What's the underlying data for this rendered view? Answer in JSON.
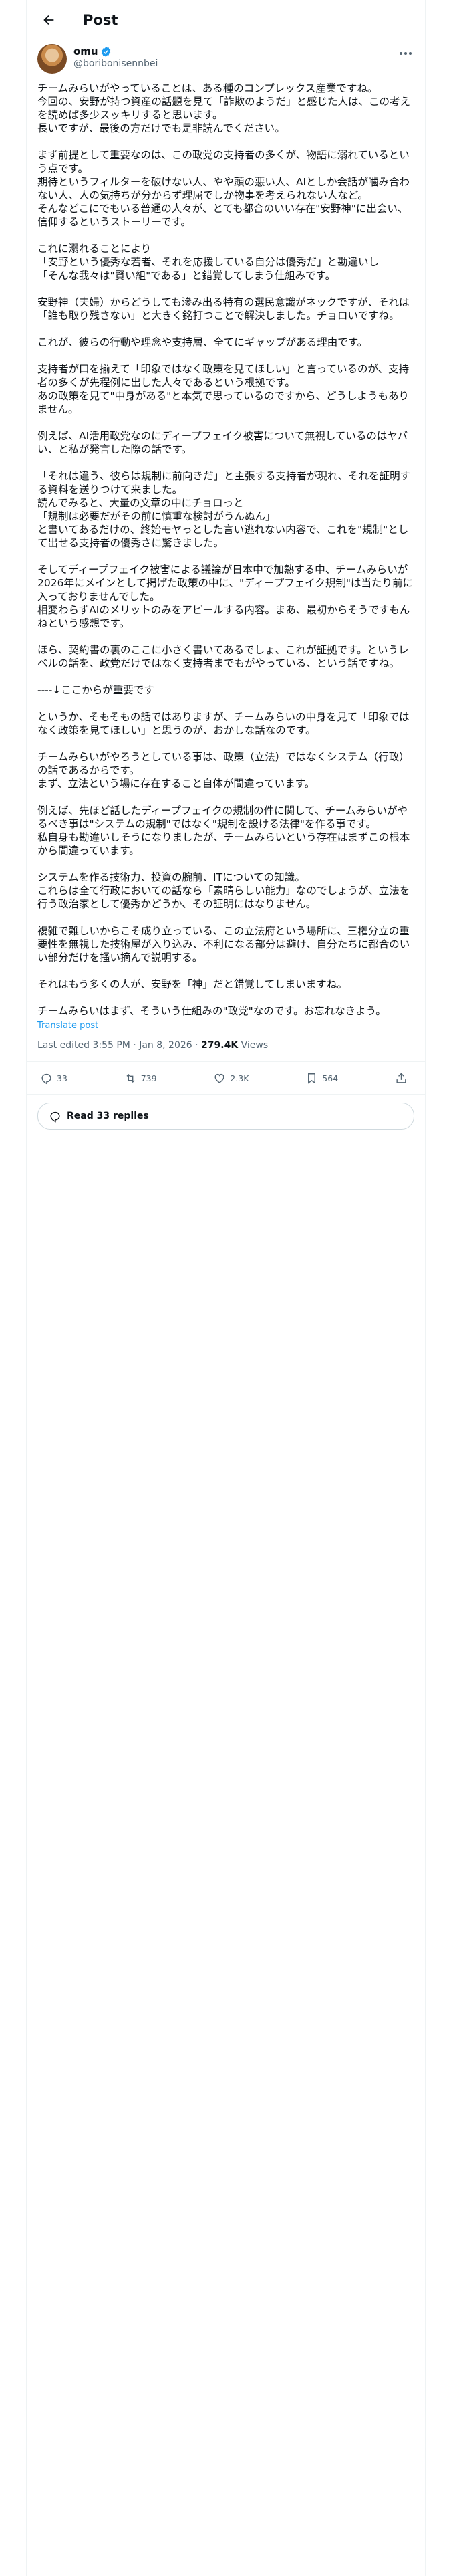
{
  "header": {
    "title": "Post"
  },
  "author": {
    "display_name": "omu",
    "handle": "@boribonisennbei"
  },
  "post": {
    "paragraphs": [
      [
        "チームみらいがやっていることは、ある種のコンプレックス産業ですね。",
        "今回の、安野が持つ資産の話題を見て「詐欺のようだ」と感じた人は、この考えを読めば多少スッキリすると思います。",
        "長いですが、最後の方だけでも是非読んでください。"
      ],
      [
        "まず前提として重要なのは、この政党の支持者の多くが、物語に溺れているという点です。",
        "期待というフィルターを破けない人、やや頭の悪い人、AIとしか会話が噛み合わない人、人の気持ちが分からず理屈でしか物事を考えられない人など。",
        "そんなどこにでもいる普通の人々が、とても都合のいい存在\"安野神\"に出会い、信仰するというストーリーです。"
      ],
      [
        "これに溺れることにより",
        "「安野という優秀な若者、それを応援している自分は優秀だ」と勘違いし",
        "「そんな我々は\"賢い組\"である」と錯覚してしまう仕組みです。"
      ],
      [
        "安野神（夫婦）からどうしても滲み出る特有の選民意識がネックですが、それは「誰も取り残さない」と大きく銘打つことで解決しました。チョロいですね。"
      ],
      [
        "これが、彼らの行動や理念や支持層、全てにギャップがある理由です。"
      ],
      [
        "支持者が口を揃えて「印象ではなく政策を見てほしい」と言っているのが、支持者の多くが先程例に出した人々であるという根拠です。",
        "あの政策を見て\"中身がある\"と本気で思っているのですから、どうしようもありません。"
      ],
      [
        "例えば、AI活用政党なのにディープフェイク被害について無視しているのはヤバい、と私が発言した際の話です。"
      ],
      [
        "「それは違う、彼らは規制に前向きだ」と主張する支持者が現れ、それを証明する資料を送りつけて来ました。",
        "読んでみると、大量の文章の中にチョロっと",
        "「規制は必要だがその前に慎重な検討がうんぬん」",
        "と書いてあるだけの、終始モヤっとした言い逃れない内容で、これを\"規制\"として出せる支持者の優秀さに驚きました。"
      ],
      [
        "そしてディープフェイク被害による議論が日本中で加熱する中、チームみらいが2026年にメインとして掲げた政策の中に、\"ディープフェイク規制\"は当たり前に入っておりませんでした。",
        "相変わらずAIのメリットのみをアピールする内容。まあ、最初からそうですもんねという感想です。"
      ],
      [
        "ほら、契約書の裏のここに小さく書いてあるでしょ、これが証拠です。というレベルの話を、政党だけではなく支持者までもがやっている、という話ですね。"
      ],
      [
        "----↓ここからが重要です"
      ],
      [
        "というか、そもそもの話ではありますが、チームみらいの中身を見て「印象ではなく政策を見てほしい」と思うのが、おかしな話なのです。"
      ],
      [
        "チームみらいがやろうとしている事は、政策（立法）ではなくシステム（行政）の話であるからです。",
        "まず、立法という場に存在すること自体が間違っています。"
      ],
      [
        "例えば、先ほど話したディープフェイクの規制の件に関して、チームみらいがやるべき事は\"システムの規制\"ではなく\"規制を設ける法律\"を作る事です。",
        "私自身も勘違いしそうになりましたが、チームみらいという存在はまずこの根本から間違っています。"
      ],
      [
        "システムを作る技術力、投資の腕前、ITについての知識。",
        "これらは全て行政においての話なら「素晴らしい能力」なのでしょうが、立法を行う政治家として優秀かどうか、その証明にはなりません。"
      ],
      [
        "複雑で難しいからこそ成り立っている、この立法府という場所に、三権分立の重要性を無視した技術屋が入り込み、不利になる部分は避け、自分たちに都合のいい部分だけを掻い摘んで説明する。"
      ],
      [
        "それはもう多くの人が、安野を「神」だと錯覚してしまいますね。"
      ],
      [
        "チームみらいはまず、そういう仕組みの\"政党\"なのです。お忘れなきよう。"
      ]
    ],
    "translate_label": "Translate post",
    "meta": {
      "edited": "Last edited 3:55 PM · Jan 8, 2026",
      "sep": " · ",
      "views_count": "279.4K",
      "views_label": " Views"
    }
  },
  "actions": {
    "replies": "33",
    "reposts": "739",
    "likes": "2.3K",
    "bookmarks": "564"
  },
  "read_replies_label": "Read 33 replies"
}
